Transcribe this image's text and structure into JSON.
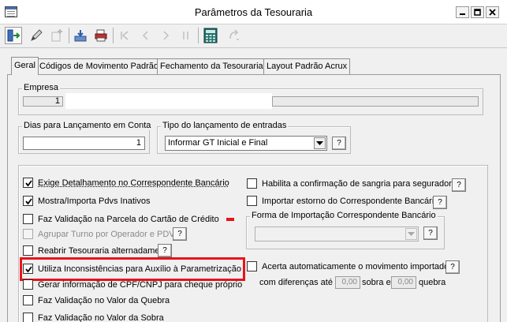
{
  "window": {
    "title": "Parâmetros da Tesouraria"
  },
  "toolbar": {
    "buttons": [
      "exit-icon",
      "edit-icon",
      "add-icon",
      "save-icon",
      "print-icon",
      "first-icon",
      "prev-icon",
      "next-icon",
      "last-icon",
      "calculator-icon",
      "refresh-icon"
    ]
  },
  "tabs": [
    {
      "label": "Geral"
    },
    {
      "label": "Códigos de Movimento Padrão"
    },
    {
      "label": "Fechamento da Tesouraria"
    },
    {
      "label": "Layout Padrão Acrux"
    }
  ],
  "empresa": {
    "label": "Empresa",
    "code": "1"
  },
  "dias": {
    "label": "Dias para Lançamento em Conta",
    "value": "1"
  },
  "tipo": {
    "label": "Tipo do lançamento de entradas",
    "value": "Informar GT Inicial e Final",
    "help": "?"
  },
  "left_options": [
    {
      "label": "Exige Detalhamento no Correspondente Bancário",
      "checked": true,
      "enabled": true
    },
    {
      "label": "Mostra/Importa Pdvs Inativos",
      "checked": true,
      "enabled": true
    },
    {
      "label": "Faz Validação na Parcela do Cartão de Crédito",
      "checked": false,
      "enabled": true
    },
    {
      "label": "Agrupar Turno por Operador e PDV",
      "checked": false,
      "enabled": false
    },
    {
      "label": "Reabrir Tesouraria alternadamente",
      "checked": false,
      "enabled": true
    },
    {
      "label": "Utiliza Inconsistências para Auxílio à Parametrização",
      "checked": true,
      "enabled": true
    },
    {
      "label": "Gerar informação de CPF/CNPJ para cheque próprio",
      "checked": false,
      "enabled": true
    },
    {
      "label": "Faz Validação no Valor da Quebra",
      "checked": false,
      "enabled": true
    },
    {
      "label": "Faz Validação no Valor da Sobra",
      "checked": false,
      "enabled": true
    }
  ],
  "right_options": {
    "sangria": {
      "label": "Habilita a confirmação de sangria para seguradora",
      "checked": false
    },
    "estorno": {
      "label": "Importar estorno do Correspondente Bancário",
      "checked": false
    },
    "forma_label": "Forma de Importação Correspondente Bancário",
    "acerta": {
      "label": "Acerta automaticamente o movimento importado",
      "checked": false
    },
    "diferencas_prefix": "com diferenças até",
    "sobra_value": "0,00",
    "sobra_label": "sobra e",
    "quebra_value": "0,00",
    "quebra_label": "quebra"
  },
  "help_label": "?"
}
